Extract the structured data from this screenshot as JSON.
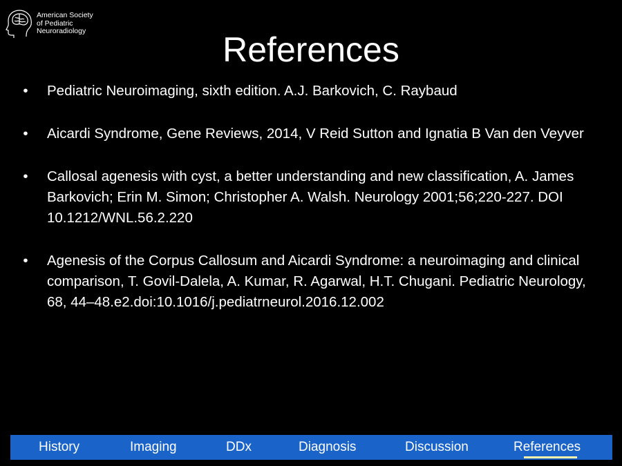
{
  "logo": {
    "line1": "American Society",
    "line2": "of Pediatric",
    "line3": "Neuroradiology",
    "icon": "brain-head-icon"
  },
  "title": "References",
  "references": [
    "Pediatric Neuroimaging, sixth edition. A.J. Barkovich, C. Raybaud",
    "Aicardi Syndrome, Gene Reviews, 2014, V Reid Sutton and Ignatia B Van den Veyver",
    "Callosal agenesis with cyst, a better understanding and new classification, A. James Barkovich; Erin M. Simon; Christopher A. Walsh. Neurology 2001;56;220-227. DOI 10.1212/WNL.56.2.220",
    "Agenesis of the Corpus Callosum and Aicardi Syndrome: a neuroimaging and clinical comparison, T. Govil-Dalela, A. Kumar, R. Agarwal, H.T. Chugani. Pediatric Neurology, 68, 44–48.e2.doi:10.1016/j.pediatrneurol.2016.12.002"
  ],
  "bullet": "•",
  "nav": {
    "items": [
      "History",
      "Imaging",
      "DDx",
      "Diagnosis",
      "Discussion",
      "References"
    ],
    "active": "References",
    "bar_color": "#1a63c9",
    "active_underline_color": "#fff2a8"
  }
}
